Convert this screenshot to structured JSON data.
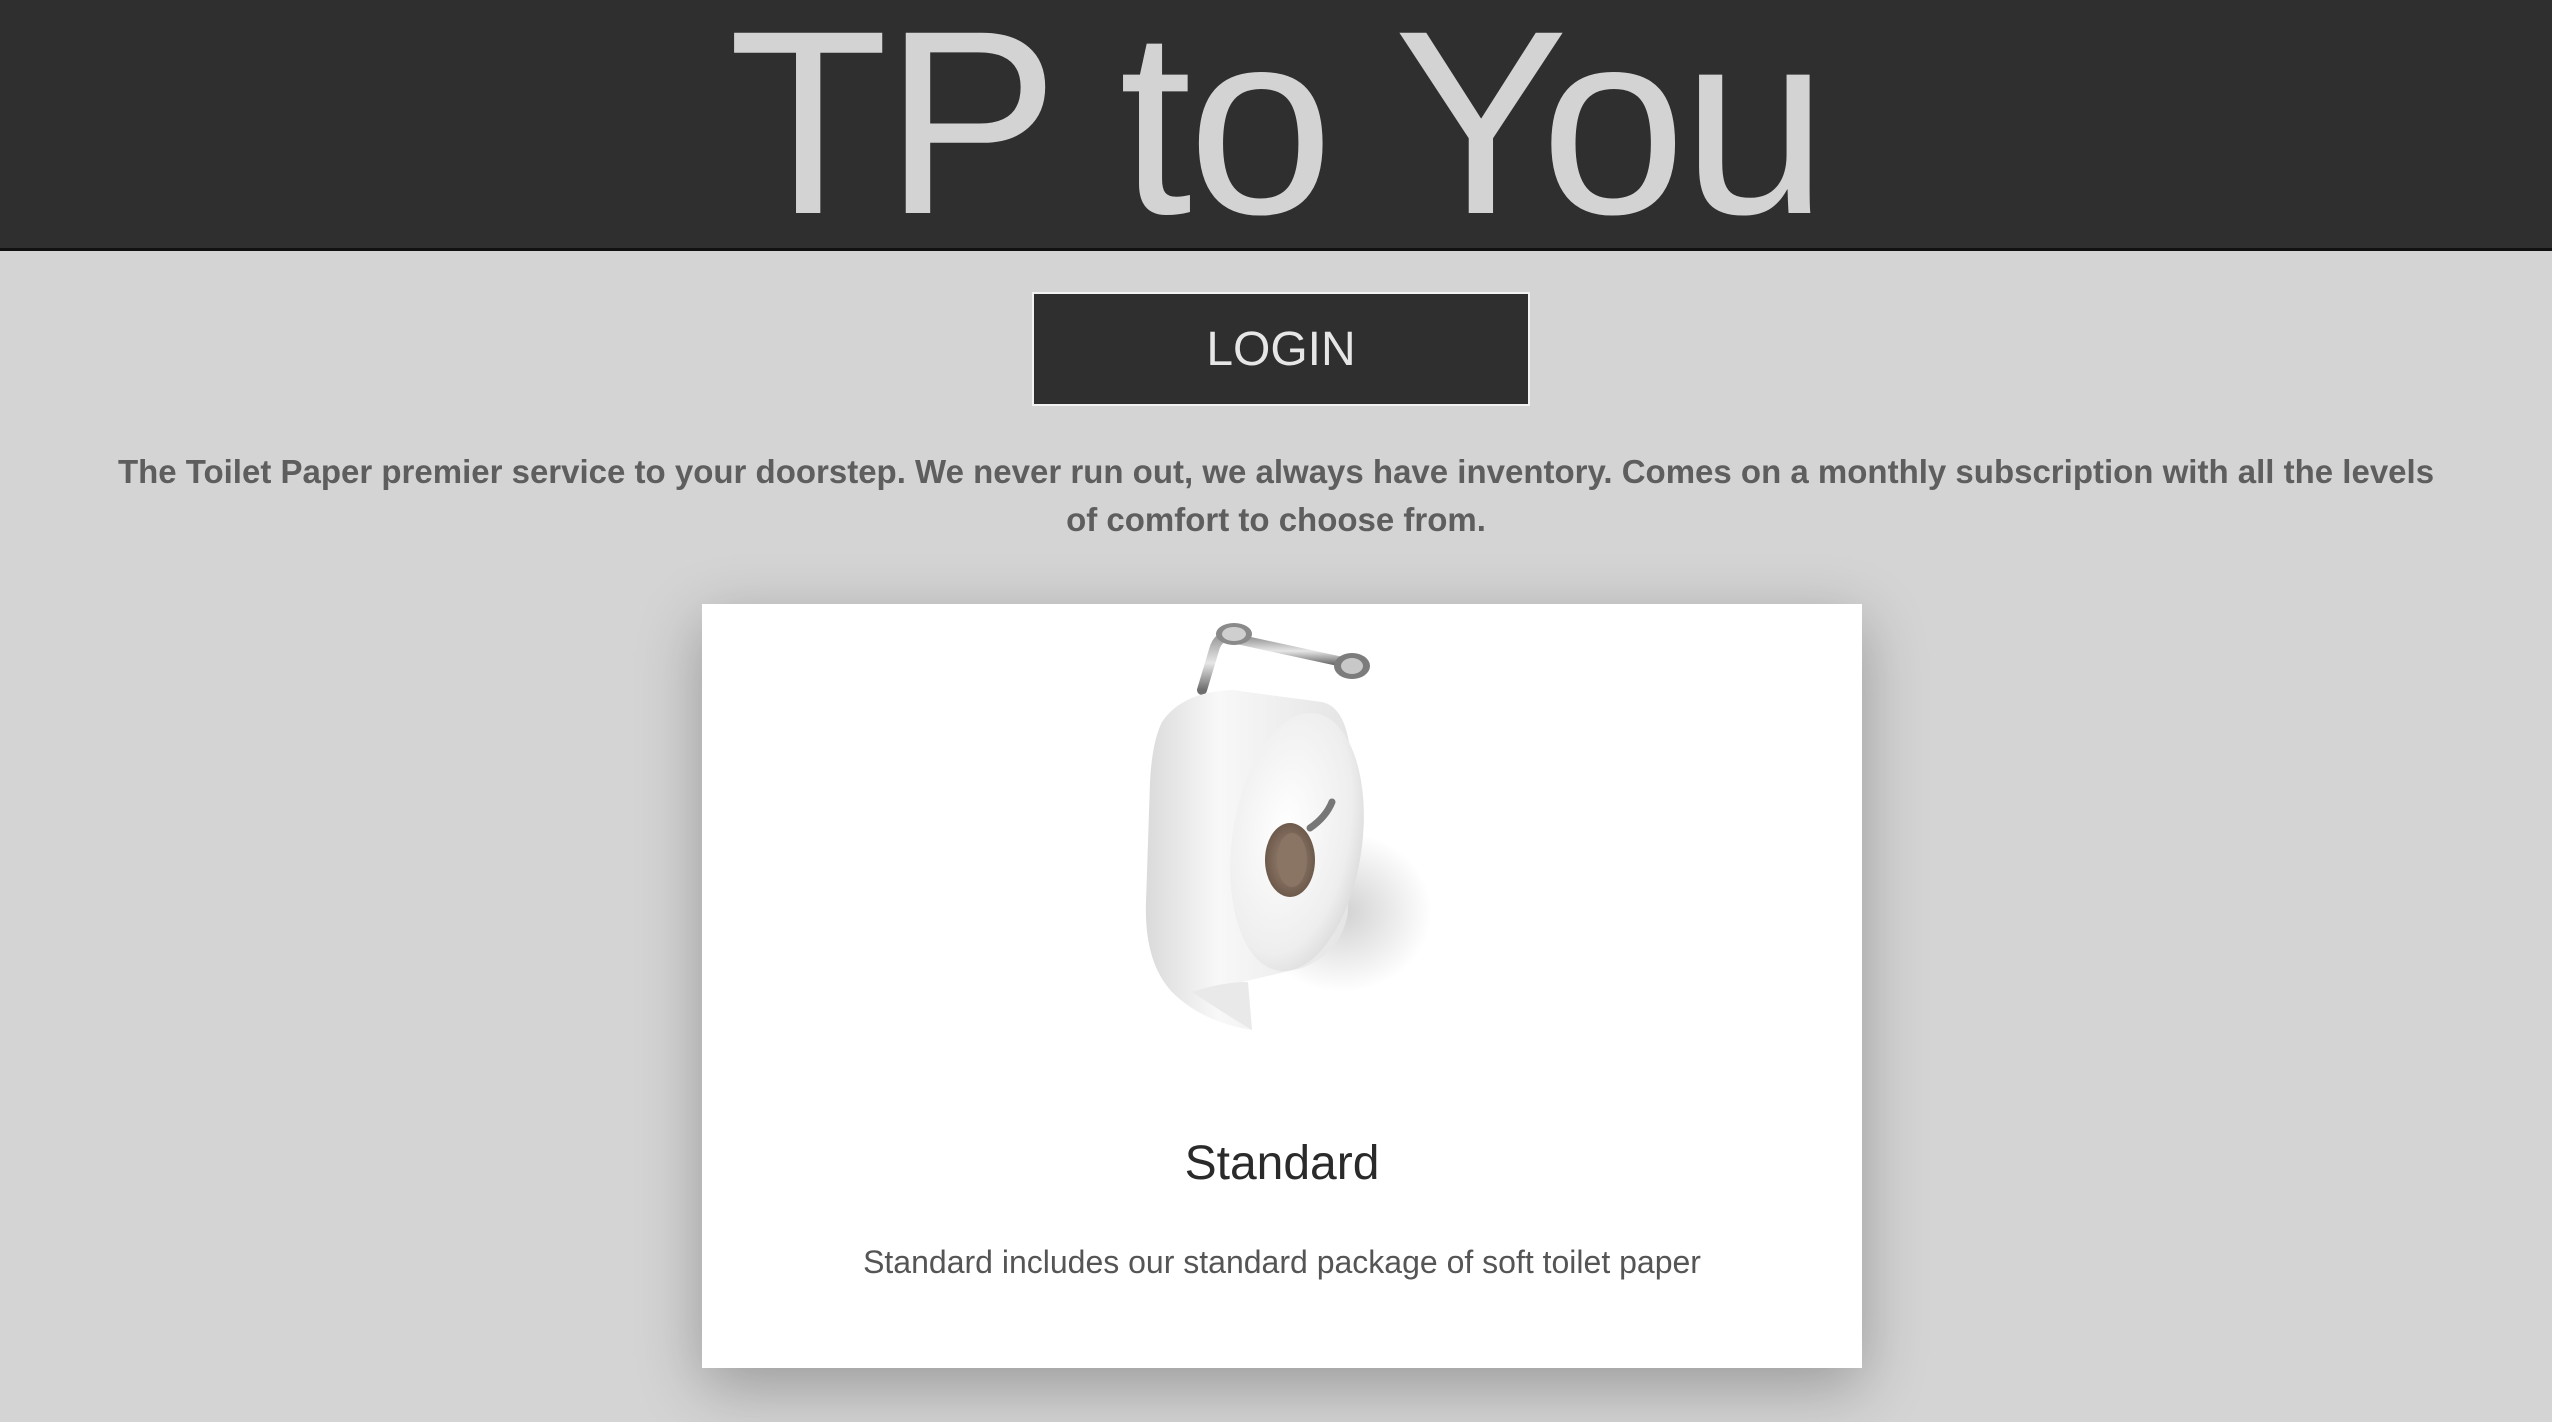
{
  "header": {
    "title": "TP to You"
  },
  "login": {
    "label": "LOGIN"
  },
  "tagline": "The Toilet Paper premier service to your doorstep. We never run out, we always have inventory. Comes on a monthly subscription with all the levels of comfort to choose from.",
  "card": {
    "image_icon": "toilet-paper-roll-on-holder",
    "title": "Standard",
    "description": "Standard includes our standard package of soft toilet paper"
  },
  "colors": {
    "header_bg": "#2f2f2f",
    "page_bg": "#d4d4d4",
    "title_text": "#d3d3d3",
    "tagline_text": "#5e5e5e",
    "card_bg": "#ffffff"
  }
}
